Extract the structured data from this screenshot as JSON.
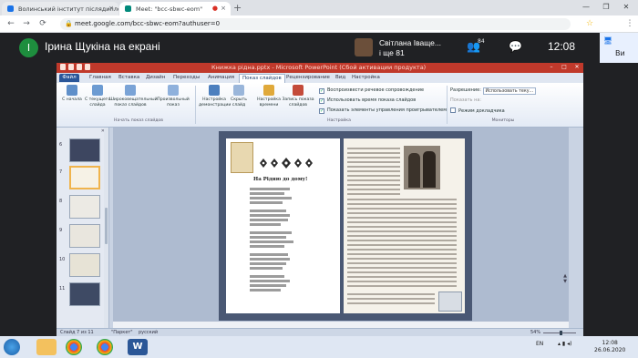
{
  "browser": {
    "tabs": [
      {
        "title": "Волинський інститут післядипло",
        "close": "×"
      },
      {
        "title": "Meet: \"bcc-sbwc-eom\"",
        "close": "×"
      }
    ],
    "new_tab": "+",
    "window_controls": [
      "—",
      "❐",
      "✕"
    ],
    "url": "meet.google.com/bcc-sbwc-eom?authuser=0",
    "nav": {
      "back": "←",
      "forward": "→",
      "reload": "⟳"
    }
  },
  "meet": {
    "presenter_initial": "І",
    "presenter_label": "Ірина Щукіна на екрані",
    "tile_name": "Світлана Іваще...",
    "tile_more": "і ще 81",
    "participants_count": "84",
    "time": "12:08",
    "self_label": "Ви",
    "icons": [
      "people-icon",
      "chat-icon",
      "present-icon"
    ]
  },
  "powerpoint": {
    "title": "Книжка рідна.pptx - Microsoft PowerPoint (Сбой активации продукта)",
    "tabs": [
      "Файл",
      "Главная",
      "Вставка",
      "Дизайн",
      "Переходы",
      "Анимация",
      "Показ слайдов",
      "Рецензирование",
      "Вид",
      "Настройка"
    ],
    "active_tab": "Показ слайдов",
    "ribbon_buttons": [
      {
        "label": "С начала"
      },
      {
        "label": "С текущего слайда"
      },
      {
        "label": "Широковещательный показ слайдов"
      },
      {
        "label": "Произвольный показ"
      },
      {
        "label": "Настройка демонстрации"
      },
      {
        "label": "Скрыть слайд"
      },
      {
        "label": "Настройка времени"
      },
      {
        "label": "Запись показа слайдов"
      }
    ],
    "checkboxes": [
      {
        "label": "Воспроизвести речевое сопровождение",
        "checked": true
      },
      {
        "label": "Использовать время показа слайдов",
        "checked": true
      },
      {
        "label": "Показать элементы управления проигрывателем",
        "checked": true
      }
    ],
    "groups": [
      "Начать показ слайдов",
      "Настройка",
      "Мониторы"
    ],
    "monitor": {
      "resolution_label": "Разрешение:",
      "resolution_value": "Использовать теку...",
      "show_on_label": "Показать на:",
      "presenter_view": "Режим докладчика"
    },
    "thumbnail_numbers": [
      "6",
      "7",
      "8",
      "9",
      "10",
      "11"
    ],
    "selected_slide": "7",
    "slide": {
      "poem_title": "На Рідню до дому!"
    },
    "status": {
      "slide": "Слайд 7 из 11",
      "theme": "\"Паркет\"",
      "language": "русский",
      "zoom": "54%"
    }
  },
  "taskbar": {
    "language": "EN",
    "time": "12:08",
    "date": "26.06.2020"
  }
}
